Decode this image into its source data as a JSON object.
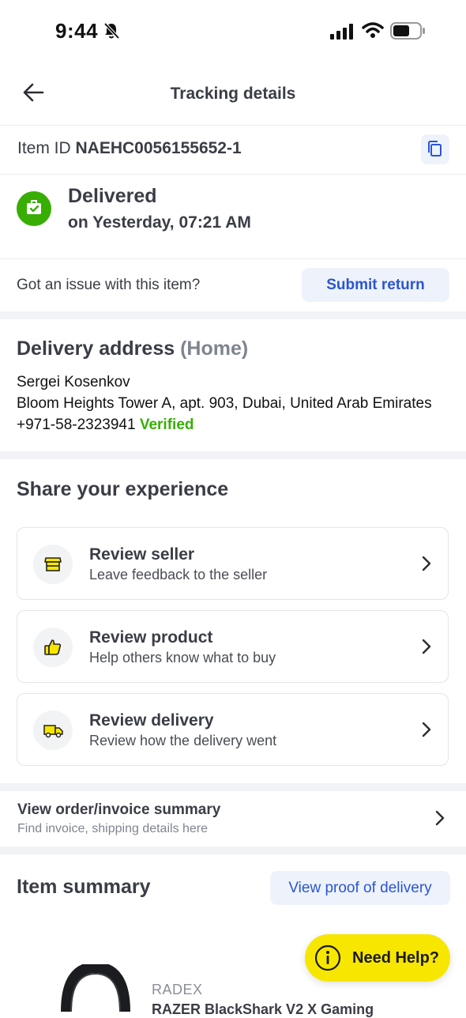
{
  "status_bar": {
    "time": "9:44"
  },
  "header": {
    "title": "Tracking details"
  },
  "item": {
    "label": "Item ID ",
    "id": "NAEHC0056155652-1"
  },
  "delivery_status": {
    "status": "Delivered",
    "when": "on Yesterday, 07:21 AM"
  },
  "issue": {
    "question": "Got an issue with this item?",
    "button_label": "Submit return"
  },
  "address": {
    "title": "Delivery address",
    "tag": "(Home)",
    "name": "Sergei Kosenkov",
    "line": "Bloom Heights Tower A, apt. 903, Dubai, United Arab Emirates",
    "phone": "+971-58-2323941",
    "verified_label": "Verified"
  },
  "share": {
    "title": "Share your experience",
    "cards": [
      {
        "title": "Review seller",
        "subtitle": "Leave feedback to the seller",
        "icon": "shop-icon"
      },
      {
        "title": "Review product",
        "subtitle": "Help others know what to buy",
        "icon": "thumbs-up-icon"
      },
      {
        "title": "Review delivery",
        "subtitle": "Review how the delivery went",
        "icon": "delivery-truck-icon"
      }
    ]
  },
  "invoice": {
    "title": "View order/invoice summary",
    "subtitle": "Find invoice, shipping details here"
  },
  "item_summary": {
    "title": "Item summary",
    "proof_button": "View proof of delivery",
    "brand": "RADEX",
    "product_name": "RAZER BlackShark V2 X Gaming"
  },
  "help_button": {
    "label": "Need Help?"
  },
  "colors": {
    "accent": "#2a55d4",
    "success": "#38ae04",
    "help": "#f7e600"
  }
}
